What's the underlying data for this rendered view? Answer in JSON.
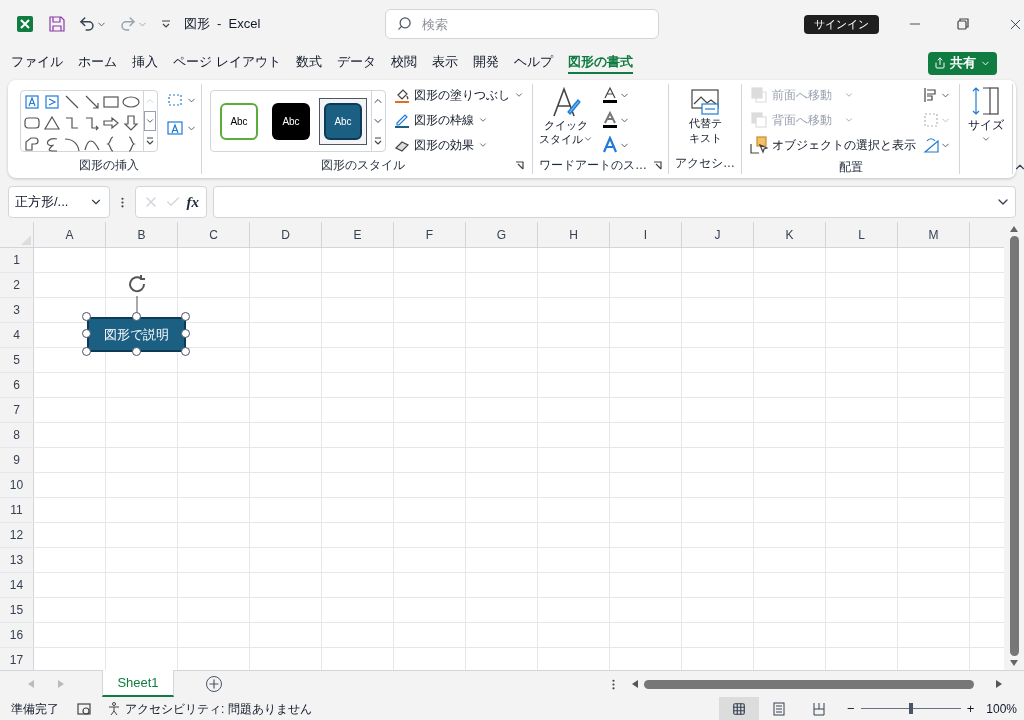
{
  "title_bar": {
    "document_title": "図形  -  Excel",
    "search": {
      "placeholder": "検索"
    },
    "sign_in": "サインイン"
  },
  "menu_tabs": [
    {
      "label": "ファイル",
      "selected": false
    },
    {
      "label": "ホーム",
      "selected": false
    },
    {
      "label": "挿入",
      "selected": false
    },
    {
      "label": "ページ レイアウト",
      "selected": false
    },
    {
      "label": "数式",
      "selected": false
    },
    {
      "label": "データ",
      "selected": false
    },
    {
      "label": "校閲",
      "selected": false
    },
    {
      "label": "表示",
      "selected": false
    },
    {
      "label": "開発",
      "selected": false
    },
    {
      "label": "ヘルプ",
      "selected": false
    },
    {
      "label": "図形の書式",
      "selected": true
    }
  ],
  "share_button": "共有",
  "ribbon": {
    "insert_shapes": {
      "label": "図形の挿入"
    },
    "shape_styles": {
      "label": "図形のスタイル",
      "presets": [
        {
          "text": "Abc",
          "kind": "outline",
          "selected": false
        },
        {
          "text": "Abc",
          "kind": "dark",
          "selected": false
        },
        {
          "text": "Abc",
          "kind": "blue",
          "selected": true
        }
      ],
      "commands": [
        {
          "label": "図形の塗りつぶし"
        },
        {
          "label": "図形の枠線"
        },
        {
          "label": "図形の効果"
        }
      ]
    },
    "wordart": {
      "label": "ワードアートのス…",
      "quick_style": [
        "クイック",
        "スタイル"
      ]
    },
    "accessibility": {
      "label": "アクセシ…",
      "alt_text": [
        "代替テ",
        "キスト"
      ]
    },
    "arrange": {
      "label": "配置",
      "commands": [
        {
          "label": "前面へ移動",
          "disabled": true
        },
        {
          "label": "背面へ移動",
          "disabled": true
        },
        {
          "label": "オブジェクトの選択と表示",
          "disabled": false
        }
      ]
    },
    "size": {
      "label": "サイズ"
    }
  },
  "formula_bar": {
    "name_box": "正方形/...",
    "function_label": "fx"
  },
  "sheet": {
    "columns": [
      "A",
      "B",
      "C",
      "D",
      "E",
      "F",
      "G",
      "H",
      "I",
      "J",
      "K",
      "L",
      "M"
    ],
    "rows": [
      "1",
      "2",
      "3",
      "4",
      "5",
      "6",
      "7",
      "8",
      "9",
      "10",
      "11",
      "12",
      "13",
      "14",
      "15",
      "16",
      "17"
    ],
    "shape": {
      "text": "図形で説明",
      "selected": true
    }
  },
  "sheet_tabs": [
    {
      "label": "Sheet1",
      "selected": true
    }
  ],
  "status_bar": {
    "ready": "準備完了",
    "accessibility": "アクセシビリティ: 問題ありません",
    "views": [
      {
        "kind": "normal",
        "selected": true
      },
      {
        "kind": "page_layout",
        "selected": false
      },
      {
        "kind": "page_break",
        "selected": false
      }
    ],
    "zoom": {
      "minus": "−",
      "plus": "+",
      "level": 0.5,
      "reading": "100%"
    }
  }
}
